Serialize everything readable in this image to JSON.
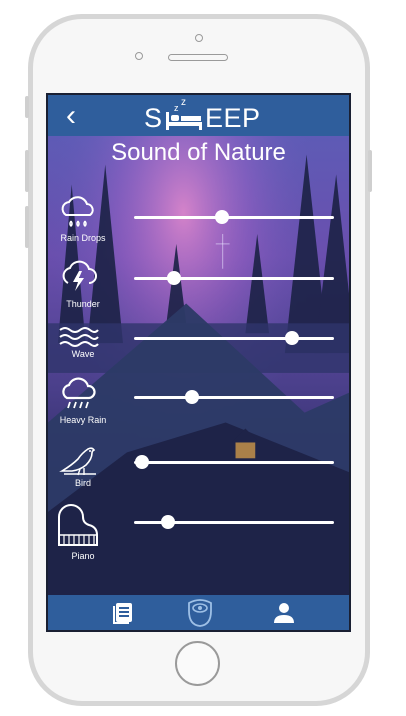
{
  "app": {
    "logo_left": "S",
    "logo_right": "EEP",
    "logo_z": "z",
    "title": "Sound of Nature"
  },
  "sounds": [
    {
      "label": "Rain Drops",
      "icon": "rain-drops-icon",
      "volume": 0.44
    },
    {
      "label": "Thunder",
      "icon": "thunder-icon",
      "volume": 0.2
    },
    {
      "label": "Wave",
      "icon": "wave-icon",
      "volume": 0.79
    },
    {
      "label": "Heavy Rain",
      "icon": "heavy-rain-icon",
      "volume": 0.29
    },
    {
      "label": "Bird",
      "icon": "bird-icon",
      "volume": 0.04
    },
    {
      "label": "Piano",
      "icon": "piano-icon",
      "volume": 0.17
    }
  ],
  "nav": [
    "list-icon",
    "sleep-mask-icon",
    "profile-icon"
  ],
  "colors": {
    "bar": "#2f5e9c",
    "text": "#ffffff",
    "frame": "#d6d6d6"
  }
}
